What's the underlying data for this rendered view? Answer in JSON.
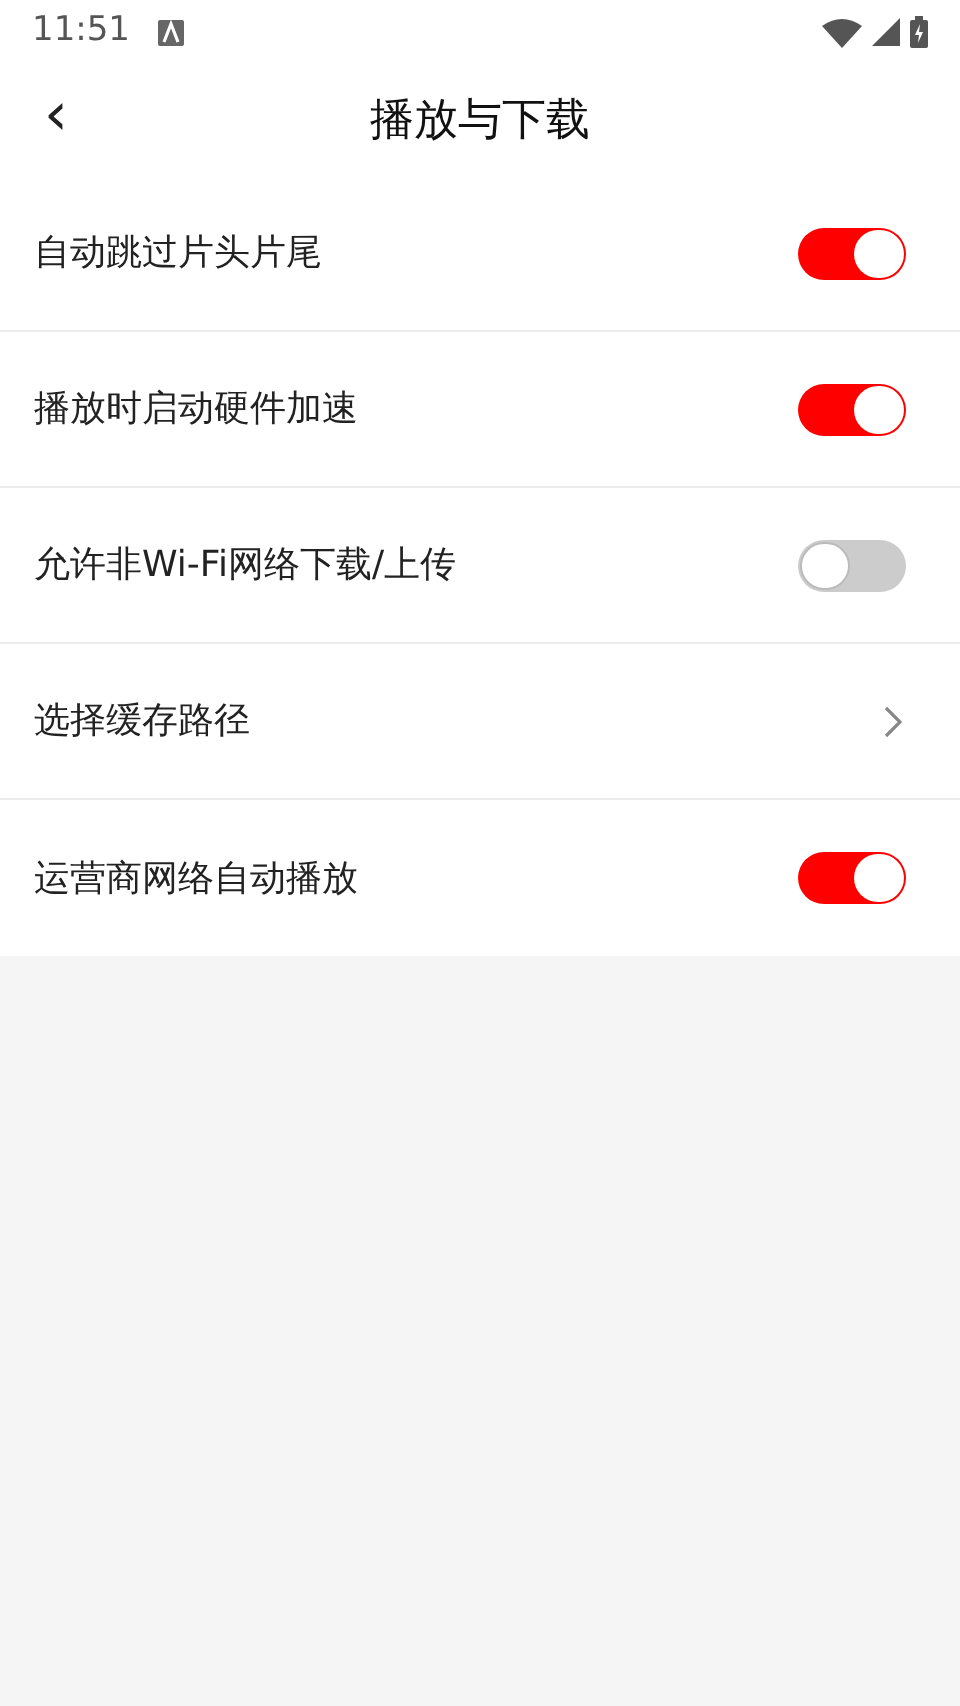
{
  "status_bar": {
    "time": "11:51"
  },
  "header": {
    "back": "‹",
    "title": "播放与下载"
  },
  "settings": [
    {
      "kind": "toggle",
      "label": "自动跳过片头片尾",
      "on": true
    },
    {
      "kind": "toggle",
      "label": "播放时启动硬件加速",
      "on": true
    },
    {
      "kind": "toggle",
      "label": "允许非Wi-Fi网络下载/上传",
      "on": false
    },
    {
      "kind": "link",
      "label": "选择缓存路径"
    },
    {
      "kind": "toggle",
      "label": "运营商网络自动播放",
      "on": true
    }
  ]
}
